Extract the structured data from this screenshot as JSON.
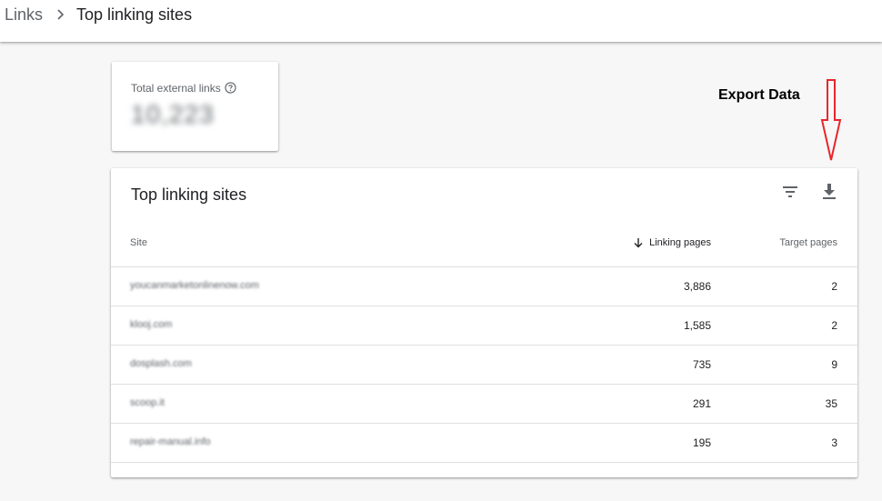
{
  "breadcrumb": {
    "parent": "Links",
    "current": "Top linking sites"
  },
  "stat": {
    "label": "Total external links",
    "value": "10,223"
  },
  "annotation": {
    "text": "Export Data",
    "color": "#e8262c"
  },
  "table": {
    "title": "Top linking sites",
    "columns": {
      "site": "Site",
      "linking": "Linking pages",
      "target": "Target pages"
    },
    "rows": [
      {
        "site": "youcanmarketonlinenow.com",
        "linking": "3,886",
        "target": "2"
      },
      {
        "site": "klooj.com",
        "linking": "1,585",
        "target": "2"
      },
      {
        "site": "dosplash.com",
        "linking": "735",
        "target": "9"
      },
      {
        "site": "scoop.it",
        "linking": "291",
        "target": "35"
      },
      {
        "site": "repair-manual.info",
        "linking": "195",
        "target": "3"
      }
    ]
  }
}
